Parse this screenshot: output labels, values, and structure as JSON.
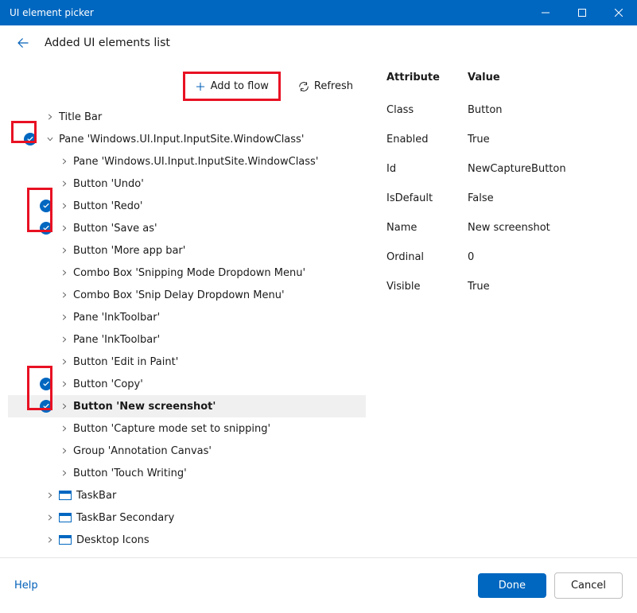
{
  "window": {
    "title": "UI element picker"
  },
  "header": {
    "title": "Added UI elements list"
  },
  "toolbar": {
    "add_label": "Add to flow",
    "refresh_label": "Refresh"
  },
  "tree": {
    "items": [
      {
        "label": "Title Bar",
        "indent": 1,
        "chev": "right",
        "checked": false,
        "win": false,
        "bold": false
      },
      {
        "label": "Pane 'Windows.UI.Input.InputSite.WindowClass'",
        "indent": 1,
        "chev": "down",
        "checked": true,
        "win": false,
        "bold": false
      },
      {
        "label": "Pane 'Windows.UI.Input.InputSite.WindowClass'",
        "indent": 2,
        "chev": "right",
        "checked": false,
        "win": false,
        "bold": false
      },
      {
        "label": "Button 'Undo'",
        "indent": 2,
        "chev": "right",
        "checked": false,
        "win": false,
        "bold": false
      },
      {
        "label": "Button 'Redo'",
        "indent": 2,
        "chev": "right",
        "checked": true,
        "win": false,
        "bold": false
      },
      {
        "label": "Button 'Save as'",
        "indent": 2,
        "chev": "right",
        "checked": true,
        "win": false,
        "bold": false
      },
      {
        "label": "Button 'More app bar'",
        "indent": 2,
        "chev": "right",
        "checked": false,
        "win": false,
        "bold": false
      },
      {
        "label": "Combo Box 'Snipping Mode Dropdown Menu'",
        "indent": 2,
        "chev": "right",
        "checked": false,
        "win": false,
        "bold": false
      },
      {
        "label": "Combo Box 'Snip Delay Dropdown Menu'",
        "indent": 2,
        "chev": "right",
        "checked": false,
        "win": false,
        "bold": false
      },
      {
        "label": "Pane 'InkToolbar'",
        "indent": 2,
        "chev": "right",
        "checked": false,
        "win": false,
        "bold": false
      },
      {
        "label": "Pane 'InkToolbar'",
        "indent": 2,
        "chev": "right",
        "checked": false,
        "win": false,
        "bold": false
      },
      {
        "label": "Button 'Edit in Paint'",
        "indent": 2,
        "chev": "right",
        "checked": false,
        "win": false,
        "bold": false
      },
      {
        "label": "Button 'Copy'",
        "indent": 2,
        "chev": "right",
        "checked": true,
        "win": false,
        "bold": false
      },
      {
        "label": "Button 'New screenshot'",
        "indent": 2,
        "chev": "right",
        "checked": true,
        "win": false,
        "bold": true
      },
      {
        "label": "Button 'Capture mode set to snipping'",
        "indent": 2,
        "chev": "right",
        "checked": false,
        "win": false,
        "bold": false
      },
      {
        "label": "Group 'Annotation Canvas'",
        "indent": 2,
        "chev": "right",
        "checked": false,
        "win": false,
        "bold": false
      },
      {
        "label": "Button 'Touch Writing'",
        "indent": 2,
        "chev": "right",
        "checked": false,
        "win": false,
        "bold": false
      },
      {
        "label": "TaskBar",
        "indent": 1,
        "chev": "right",
        "checked": false,
        "win": true,
        "bold": false
      },
      {
        "label": "TaskBar Secondary",
        "indent": 1,
        "chev": "right",
        "checked": false,
        "win": true,
        "bold": false
      },
      {
        "label": "Desktop Icons",
        "indent": 1,
        "chev": "right",
        "checked": false,
        "win": true,
        "bold": false
      }
    ]
  },
  "attributes": {
    "header_attr": "Attribute",
    "header_val": "Value",
    "rows": [
      {
        "k": "Class",
        "v": "Button"
      },
      {
        "k": "Enabled",
        "v": "True"
      },
      {
        "k": "Id",
        "v": "NewCaptureButton"
      },
      {
        "k": "IsDefault",
        "v": "False"
      },
      {
        "k": "Name",
        "v": "New screenshot"
      },
      {
        "k": "Ordinal",
        "v": "0"
      },
      {
        "k": "Visible",
        "v": "True"
      }
    ]
  },
  "footer": {
    "help": "Help",
    "done": "Done",
    "cancel": "Cancel"
  }
}
